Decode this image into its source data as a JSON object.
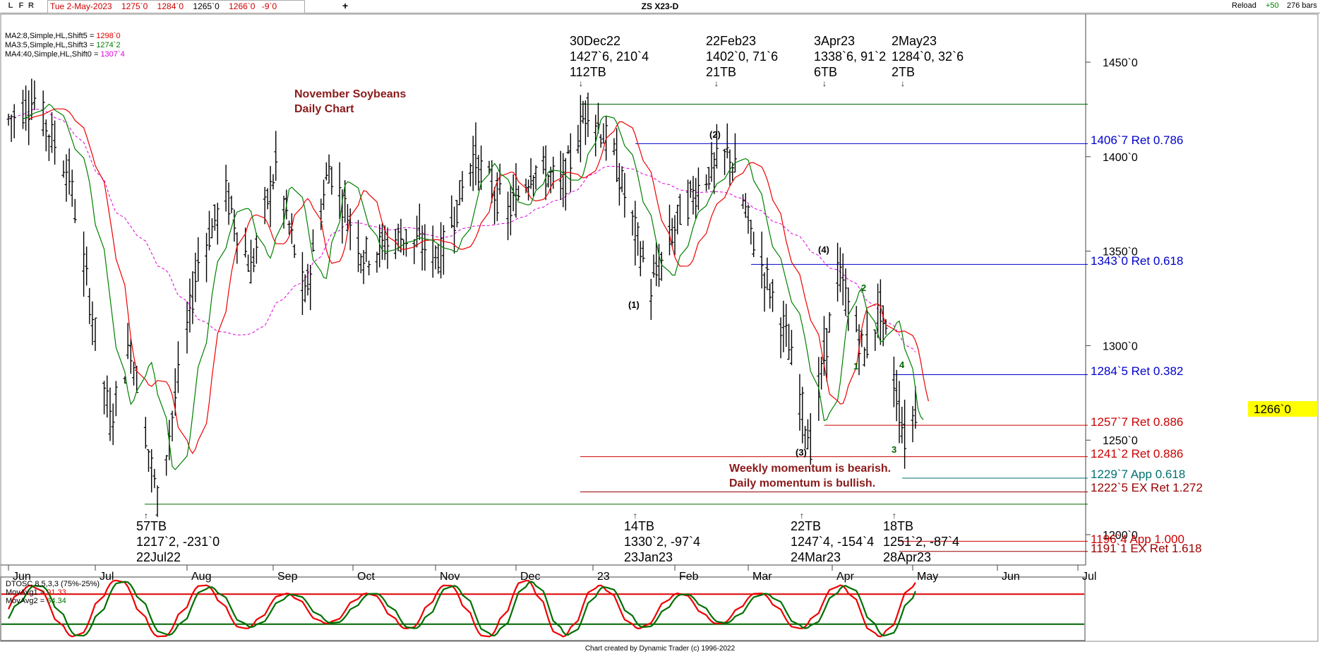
{
  "toolbar": {
    "btn_l": "L",
    "btn_f": "F",
    "btn_r": "R",
    "date": "Tue 2-May-2023",
    "open": "1275`0",
    "high": "1284`0",
    "low": "1265`0",
    "close": "1266`0",
    "change": "-9`0",
    "add": "+",
    "symbol": "ZS X23-D",
    "reload": "Reload",
    "reload_delta": "+50",
    "bars": "276 bars"
  },
  "ma_legend": [
    {
      "text": "MA2:8,Simple,HL,Shift5 = ",
      "value": "1298`0",
      "color": "#e00000"
    },
    {
      "text": "MA3:5,Simple,HL,Shift3 = ",
      "value": "1274`2",
      "color": "#008000"
    },
    {
      "text": "MA4:40,Simple,HL,Shift0 = ",
      "value": "1307`4",
      "color": "#e000e0"
    }
  ],
  "chart_title": [
    "November Soybeans",
    "Daily Chart"
  ],
  "price_badge": "1266`0",
  "top_annotations": [
    {
      "lines": [
        "30Dec22",
        "1427`6, 210`4",
        "112TB"
      ]
    },
    {
      "lines": [
        "22Feb23",
        "1402`0, 71`6",
        "21TB"
      ]
    },
    {
      "lines": [
        "3Apr23",
        "1338`6, 91`2",
        " 6TB"
      ]
    },
    {
      "lines": [
        "2May23",
        "1284`0, 32`6",
        "2TB"
      ]
    }
  ],
  "bottom_annotations": [
    {
      "lines": [
        "57TB",
        "1217`2, -231`0",
        "22Jul22"
      ]
    },
    {
      "lines": [
        "14TB",
        "1330`2, -97`4",
        "23Jan23"
      ]
    },
    {
      "lines": [
        "22TB",
        "1247`4, -154`4",
        "24Mar23"
      ]
    },
    {
      "lines": [
        "18TB",
        "1251`2, -87`4",
        "28Apr23"
      ]
    }
  ],
  "wave_labels": [
    "(1)",
    "(2)",
    "(3)",
    "(4)",
    "1",
    "2",
    "3",
    "4"
  ],
  "levels": [
    {
      "label": "1406`7 Ret 0.786",
      "price": 1406.875,
      "color": "#0000cc"
    },
    {
      "label": "1343`0 Ret 0.618",
      "price": 1343.0,
      "color": "#0000cc"
    },
    {
      "label": "1284`5 Ret 0.382",
      "price": 1284.625,
      "color": "#0000cc"
    },
    {
      "label": "1257`7 Ret 0.886",
      "price": 1257.875,
      "color": "#cc0000"
    },
    {
      "label": "1241`2 Ret 0.886",
      "price": 1241.25,
      "color": "#cc0000"
    },
    {
      "label": "1229`7 App 0.618",
      "price": 1229.875,
      "color": "#007070"
    },
    {
      "label": "1222`5 EX Ret 1.272",
      "price": 1222.625,
      "color": "#990000"
    },
    {
      "label": "1196`4 App 1.000",
      "price": 1196.5,
      "color": "#cc0000"
    },
    {
      "label": "1191`1 EX Ret 1.618",
      "price": 1191.125,
      "color": "#990000"
    }
  ],
  "momentum_note": [
    "Weekly momentum is bearish.",
    "Daily momentum is bullish."
  ],
  "oscillator": {
    "title": "DTOSC 8,5,3,3 (75%-25%)",
    "ma1_label": "MovAvg1 = ",
    "ma1_value": "91.33",
    "ma2_label": "MovAvg2 = ",
    "ma2_value": "64.34"
  },
  "footer": "Chart created by Dynamic Trader  (c)  1996-2022",
  "chart_data": {
    "type": "ohlc-bar",
    "symbol": "ZS X23-D",
    "x_range": [
      "2022-06",
      "2023-07"
    ],
    "ylim": [
      1185,
      1475
    ],
    "y_ticks": [
      "1450`0",
      "1400`0",
      "1350`0",
      "1300`0",
      "1250`0",
      "1200`0"
    ],
    "y_tick_values": [
      1450,
      1400,
      1350,
      1300,
      1250,
      1200
    ],
    "x_ticks": [
      "Jun",
      "Jul",
      "Aug",
      "Sep",
      "Oct",
      "Nov",
      "Dec",
      "23",
      "Feb",
      "Mar",
      "Apr",
      "May",
      "Jun",
      "Jul"
    ],
    "swings": [
      {
        "date": "2022-07-22",
        "price": 1217.25
      },
      {
        "date": "2022-12-30",
        "price": 1427.75
      },
      {
        "date": "2023-01-23",
        "price": 1330.25
      },
      {
        "date": "2023-02-22",
        "price": 1402.0
      },
      {
        "date": "2023-03-24",
        "price": 1247.5
      },
      {
        "date": "2023-04-03",
        "price": 1338.75
      },
      {
        "date": "2023-04-28",
        "price": 1251.25
      },
      {
        "date": "2023-05-02",
        "price": 1266.0
      }
    ],
    "oscillator_bands": [
      75,
      25
    ],
    "colors": {
      "bars": "#000000",
      "ma8": "#ee0000",
      "ma5": "#008000",
      "ma40": "#e000e0"
    }
  }
}
